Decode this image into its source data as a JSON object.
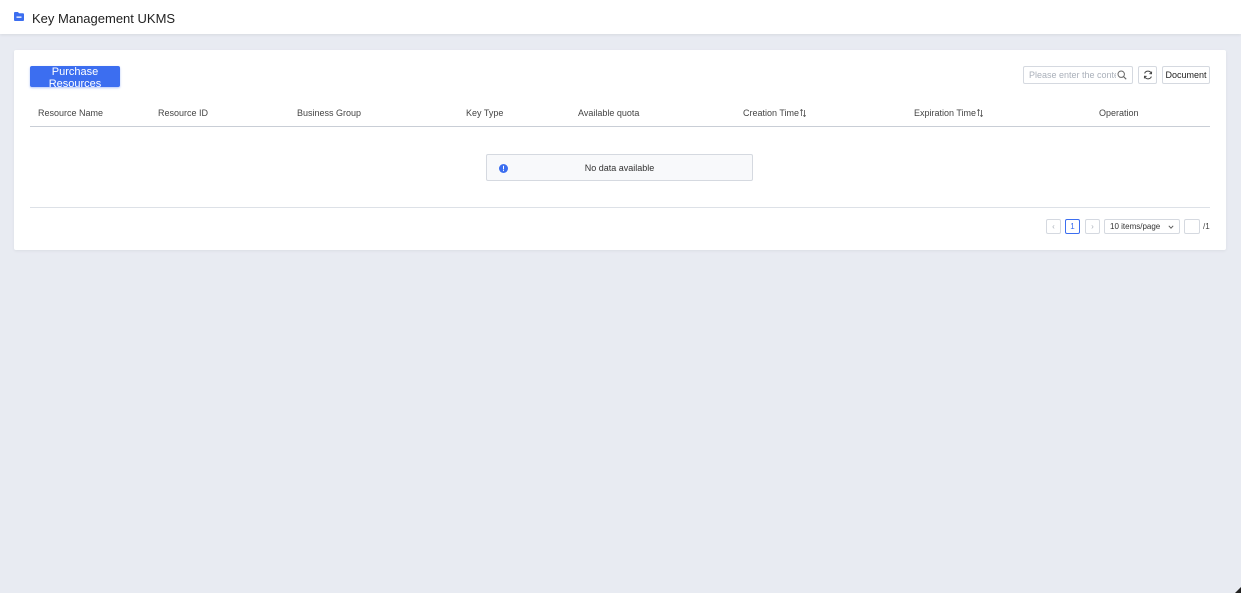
{
  "header": {
    "title": "Key Management UKMS",
    "icon": "folder-icon",
    "accent_color": "#3c6ef0"
  },
  "toolbar": {
    "purchase_label": "Purchase Resources",
    "search_placeholder": "Please enter the content",
    "search_value": "",
    "refresh_icon": "refresh-icon",
    "document_label": "Document"
  },
  "table": {
    "columns": [
      {
        "label": "Resource Name",
        "sortable": false
      },
      {
        "label": "Resource ID",
        "sortable": false
      },
      {
        "label": "Business Group",
        "sortable": false
      },
      {
        "label": "Key Type",
        "sortable": false
      },
      {
        "label": "Available quota",
        "sortable": false
      },
      {
        "label": "Creation Time",
        "sortable": true
      },
      {
        "label": "Expiration Time",
        "sortable": true
      },
      {
        "label": "Operation",
        "sortable": false
      }
    ],
    "rows": [],
    "empty_text": "No data available"
  },
  "pagination": {
    "prev": "‹",
    "current_page": "1",
    "next": "›",
    "page_size_label": "10 items/page",
    "jump_value": "",
    "total_pages": "/1"
  }
}
